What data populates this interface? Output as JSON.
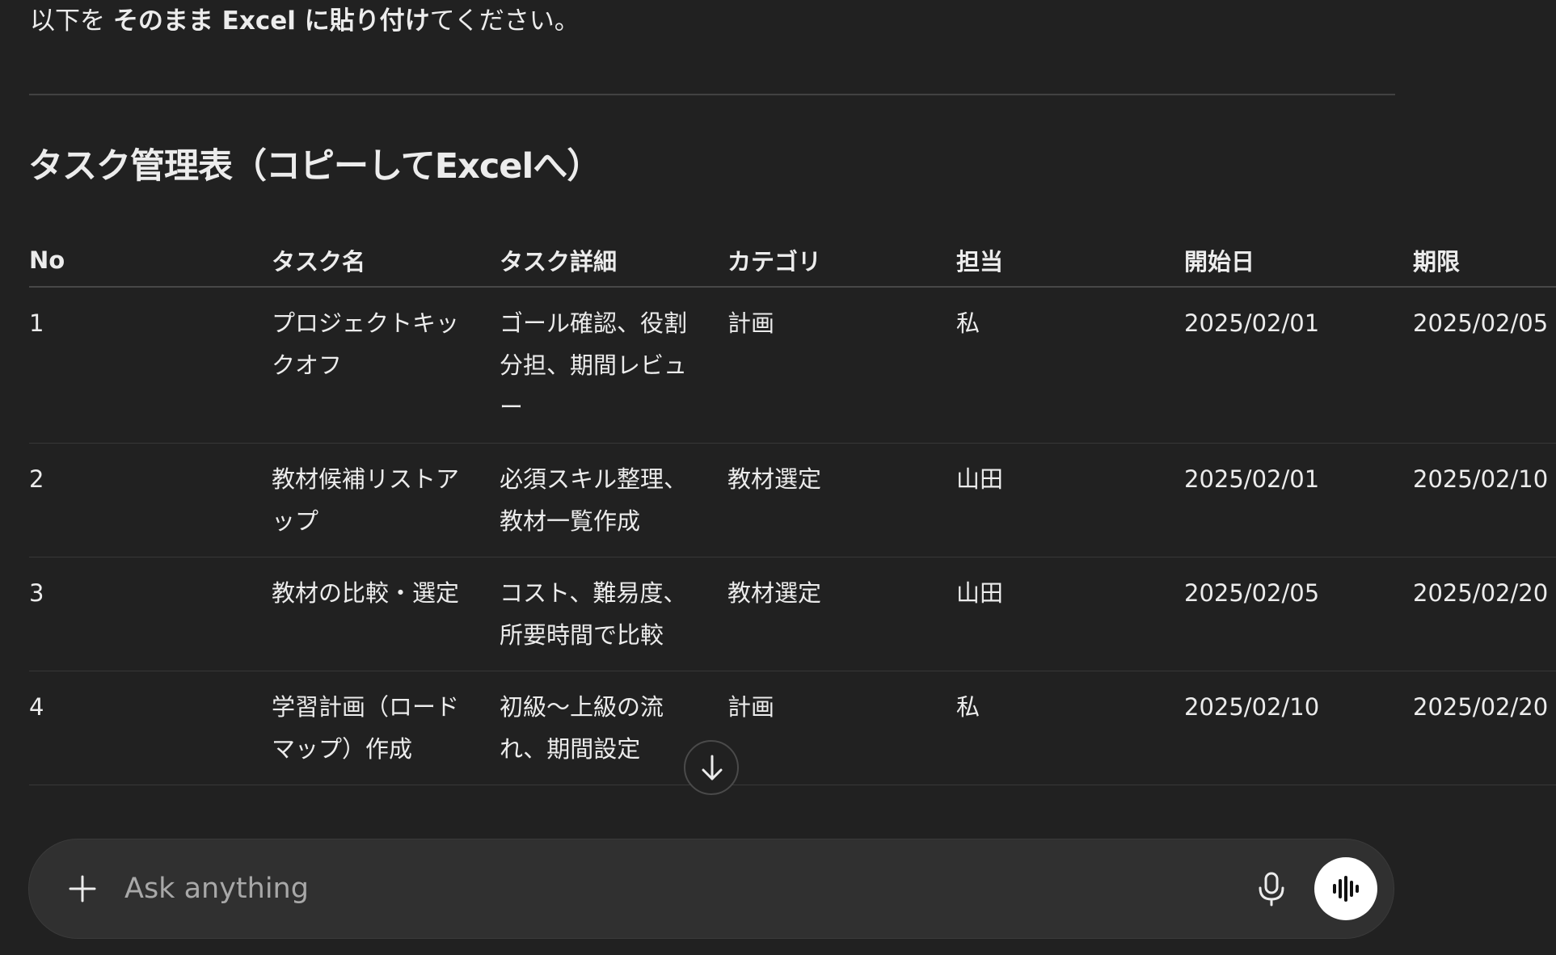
{
  "intro": {
    "prefix": "以下を ",
    "bold1": "そのまま Excel に貼り付け",
    "suffix": "てください。"
  },
  "heading": "タスク管理表（コピーしてExcelへ）",
  "table": {
    "headers": {
      "no": "No",
      "name": "タスク名",
      "detail": "タスク詳細",
      "category": "カテゴリ",
      "owner": "担当",
      "start": "開始日",
      "due": "期限"
    },
    "rows": [
      {
        "no": "1",
        "name": "プロジェクトキックオフ",
        "detail": "ゴール確認、役割分担、期間レビュー",
        "category": "計画",
        "owner": "私",
        "start": "2025/02/01",
        "due": "2025/02/05"
      },
      {
        "no": "2",
        "name": "教材候補リストアップ",
        "detail": "必須スキル整理、教材一覧作成",
        "category": "教材選定",
        "owner": "山田",
        "start": "2025/02/01",
        "due": "2025/02/10"
      },
      {
        "no": "3",
        "name": "教材の比較・選定",
        "detail": "コスト、難易度、所要時間で比較",
        "category": "教材選定",
        "owner": "山田",
        "start": "2025/02/05",
        "due": "2025/02/20"
      },
      {
        "no": "4",
        "name": "学習計画（ロードマップ）作成",
        "detail": "初級〜上級の流れ、期間設定",
        "category": "計画",
        "owner": "私",
        "start": "2025/02/10",
        "due": "2025/02/20"
      }
    ]
  },
  "composer": {
    "placeholder": "Ask anything",
    "add_icon": "plus-icon",
    "mic_icon": "microphone-icon",
    "voice_icon": "voice-waveform-icon"
  },
  "scroll_icon": "arrow-down-icon"
}
